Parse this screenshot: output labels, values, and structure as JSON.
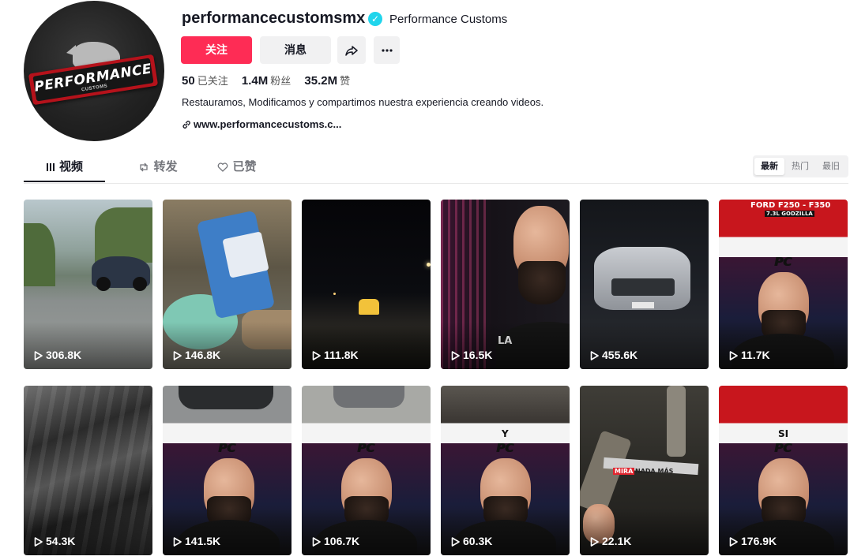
{
  "profile": {
    "username": "performancecustomsmx",
    "nickname": "Performance Customs",
    "avatar_logo_text": "PERFORMANCE",
    "avatar_logo_sub": "CUSTOMS",
    "follow_label": "关注",
    "message_label": "消息",
    "stats": [
      {
        "value": "50",
        "label": "已关注"
      },
      {
        "value": "1.4M",
        "label": "粉丝"
      },
      {
        "value": "35.2M",
        "label": "赞"
      }
    ],
    "bio": "Restauramos, Modificamos y compartimos nuestra experiencia creando videos.",
    "link": "www.performancecustoms.c..."
  },
  "tabs": [
    {
      "label": "视频",
      "icon": "grid-icon",
      "active": true
    },
    {
      "label": "转发",
      "icon": "repost-icon",
      "active": false
    },
    {
      "label": "已赞",
      "icon": "liked-heart-icon",
      "active": false
    }
  ],
  "sort": [
    "最新",
    "热门",
    "最旧"
  ],
  "videos": [
    {
      "views": "306.8K",
      "overlay": ""
    },
    {
      "views": "146.8K",
      "overlay": ""
    },
    {
      "views": "111.8K",
      "overlay": ""
    },
    {
      "views": "16.5K",
      "overlay": "LA"
    },
    {
      "views": "455.6K",
      "overlay": ""
    },
    {
      "views": "11.7K",
      "overlay": "FORD F250 - F350",
      "overlay2": "7.3L GODZILLA"
    },
    {
      "views": "54.3K",
      "overlay": ""
    },
    {
      "views": "141.5K",
      "overlay": ""
    },
    {
      "views": "106.7K",
      "overlay": ""
    },
    {
      "views": "60.3K",
      "overlay": "Y"
    },
    {
      "views": "22.1K",
      "overlay": "MIRA",
      "overlay2": "NADA MÁS"
    },
    {
      "views": "176.9K",
      "overlay": "SI"
    }
  ],
  "thumb_logo": "PC",
  "colors": {
    "accent": "#fe2c55",
    "verified": "#20d5ec"
  }
}
